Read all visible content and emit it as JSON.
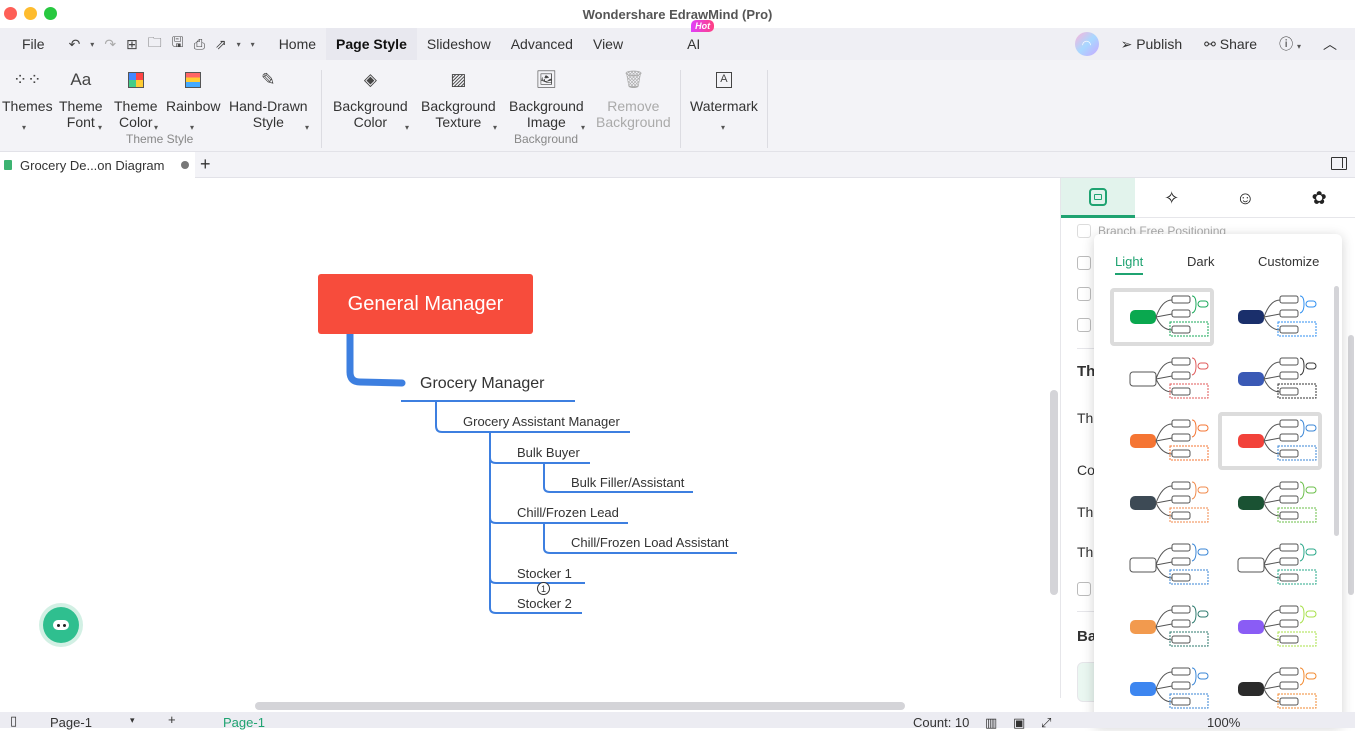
{
  "window": {
    "title": "Wondershare EdrawMind (Pro)"
  },
  "menubar": {
    "file": "File",
    "quick_actions": [
      "undo-icon",
      "redo-icon",
      "new-icon",
      "open-folder-icon",
      "save-icon",
      "print-icon",
      "export-icon",
      "more-icon"
    ],
    "tabs": [
      {
        "label": "Home",
        "active": false
      },
      {
        "label": "Page Style",
        "active": true
      },
      {
        "label": "Slideshow",
        "active": false
      },
      {
        "label": "Advanced",
        "active": false
      },
      {
        "label": "View",
        "active": false
      },
      {
        "label": "AI",
        "active": false,
        "badge": "Hot"
      }
    ],
    "publish": "Publish",
    "share": "Share"
  },
  "ribbon": {
    "theme_style": {
      "group_label": "Theme Style",
      "buttons": [
        {
          "line1": "Themes",
          "line2": ""
        },
        {
          "line1": "Theme",
          "line2": "Font"
        },
        {
          "line1": "Theme",
          "line2": "Color"
        },
        {
          "line1": "Rainbow",
          "line2": ""
        },
        {
          "line1": "Hand-Drawn",
          "line2": "Style"
        }
      ]
    },
    "background": {
      "group_label": "Background",
      "buttons": [
        {
          "line1": "Background",
          "line2": "Color",
          "disabled": false
        },
        {
          "line1": "Background",
          "line2": "Texture",
          "disabled": false
        },
        {
          "line1": "Background",
          "line2": "Image",
          "disabled": false
        },
        {
          "line1": "Remove",
          "line2": "Background",
          "disabled": true
        }
      ]
    },
    "watermark": {
      "line1": "Watermark"
    }
  },
  "doc_tab": {
    "title": "Grocery De...on Diagram",
    "unsaved": true
  },
  "mindmap": {
    "root": "General Manager",
    "nodes": [
      {
        "label": "Grocery Manager",
        "level": 1
      },
      {
        "label": "Grocery Assistant Manager",
        "level": 2
      },
      {
        "label": "Bulk Buyer",
        "level": 3
      },
      {
        "label": "Bulk Filler/Assistant",
        "level": 4
      },
      {
        "label": "Chill/Frozen Lead",
        "level": 3
      },
      {
        "label": "Chill/Frozen Load Assistant",
        "level": 4
      },
      {
        "label": "Stocker 1",
        "level": 3
      },
      {
        "label": "Stocker 2",
        "level": 3
      }
    ],
    "collapsed_badge": "1",
    "root_color": "#f74c3c",
    "branch_color": "#3d7fe0"
  },
  "right_panel": {
    "tabs": [
      "layout-icon",
      "sparkle-icon",
      "map-pin-smile-icon",
      "badge-gear-icon"
    ],
    "branch_free_positioning": "Branch Free Positioning",
    "partial_labels": [
      "Th",
      "The",
      "Col",
      "The",
      "The",
      "Ba"
    ]
  },
  "theme_popup": {
    "tabs": [
      {
        "label": "Light",
        "active": true
      },
      {
        "label": "Dark",
        "active": false
      },
      {
        "label": "Customize",
        "active": false
      }
    ],
    "themes": [
      {
        "name": "theme-green",
        "root": "#0aa84f",
        "accent": "#1aa85a",
        "selected": true
      },
      {
        "name": "theme-navy",
        "root": "#1a2f6b",
        "accent": "#2f8ff0",
        "selected": false
      },
      {
        "name": "theme-rainbow-curve",
        "root": "#ffffff",
        "accent": "#e05a5a",
        "selected": false
      },
      {
        "name": "theme-blue-soft",
        "root": "#3a59b5",
        "accent": "#333333",
        "selected": false
      },
      {
        "name": "theme-orange-dark",
        "root": "#f57533",
        "accent": "#f57533",
        "selected": false
      },
      {
        "name": "theme-red-curve",
        "root": "#f2423a",
        "accent": "#3a86d6",
        "selected": true
      },
      {
        "name": "theme-slate",
        "root": "#3d4a55",
        "accent": "#f08a4b",
        "selected": false
      },
      {
        "name": "theme-forest",
        "root": "#1a5233",
        "accent": "#6bbf4a",
        "selected": false
      },
      {
        "name": "theme-arc",
        "root": "#ffffff",
        "accent": "#3a86d6",
        "selected": false
      },
      {
        "name": "theme-outline-teal",
        "root": "#ffffff",
        "accent": "#2aa88a",
        "selected": false
      },
      {
        "name": "theme-orange-teal",
        "root": "#f29a4e",
        "accent": "#2d7a6e",
        "selected": false
      },
      {
        "name": "theme-purple-mix",
        "root": "#8a5cf5",
        "accent": "#a8e04a",
        "selected": false
      },
      {
        "name": "theme-hex-blue",
        "root": "#3d86f0",
        "accent": "#3a86d6",
        "selected": false
      },
      {
        "name": "theme-black-orange",
        "root": "#2b2b2b",
        "accent": "#f28a30",
        "selected": false
      }
    ]
  },
  "statusbar": {
    "page_select": "Page-1",
    "page_tab": "Page-1",
    "count": "Count: 10",
    "zoom": "100%"
  }
}
